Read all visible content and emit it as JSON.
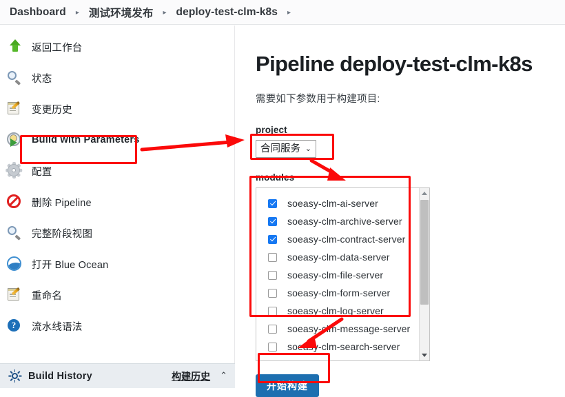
{
  "breadcrumb": {
    "separator": "▸",
    "items": [
      {
        "label": "Dashboard"
      },
      {
        "label": "测试环境发布"
      },
      {
        "label": "deploy-test-clm-k8s"
      },
      {
        "label": ""
      }
    ]
  },
  "sidebar": {
    "items": [
      {
        "label": "返回工作台",
        "icon": "up-arrow-icon",
        "name": "back-to-dashboard"
      },
      {
        "label": "状态",
        "icon": "magnifier-icon",
        "name": "status"
      },
      {
        "label": "变更历史",
        "icon": "notepad-pencil-icon",
        "name": "changes"
      },
      {
        "label": "Build with Parameters",
        "icon": "build-clock-play-icon",
        "name": "build-with-parameters"
      },
      {
        "label": "配置",
        "icon": "gear-icon",
        "name": "configure"
      },
      {
        "label": "删除 Pipeline",
        "icon": "forbidden-icon",
        "name": "delete-pipeline"
      },
      {
        "label": "完整阶段视图",
        "icon": "magnifier-icon",
        "name": "full-stage-view"
      },
      {
        "label": "打开 Blue Ocean",
        "icon": "blue-ocean-icon",
        "name": "open-blue-ocean"
      },
      {
        "label": "重命名",
        "icon": "notepad-pencil-icon",
        "name": "rename"
      },
      {
        "label": "流水线语法",
        "icon": "help-circle-icon",
        "name": "pipeline-syntax"
      }
    ]
  },
  "build_history": {
    "title": "Build History",
    "link_label": "构建历史",
    "chevron": "⌃",
    "icon": "sun-gear-icon"
  },
  "main": {
    "title": "Pipeline deploy-test-clm-k8s",
    "intro": "需要如下参数用于构建项目:",
    "project": {
      "label": "project",
      "selected": "合同服务",
      "chevron": "⌄",
      "options": [
        "合同服务"
      ]
    },
    "modules": {
      "label": "modules",
      "items": [
        {
          "name": "soeasy-clm-ai-server",
          "checked": true
        },
        {
          "name": "soeasy-clm-archive-server",
          "checked": true
        },
        {
          "name": "soeasy-clm-contract-server",
          "checked": true
        },
        {
          "name": "soeasy-clm-data-server",
          "checked": false
        },
        {
          "name": "soeasy-clm-file-server",
          "checked": false
        },
        {
          "name": "soeasy-clm-form-server",
          "checked": false
        },
        {
          "name": "soeasy-clm-log-server",
          "checked": false
        },
        {
          "name": "soeasy-clm-message-server",
          "checked": false
        },
        {
          "name": "soeasy-clm-search-server",
          "checked": false
        }
      ]
    },
    "build_button": "开始构建"
  },
  "annotations": {
    "color": "#fb0a0a",
    "highlight_count": 4,
    "arrow_count": 3
  }
}
